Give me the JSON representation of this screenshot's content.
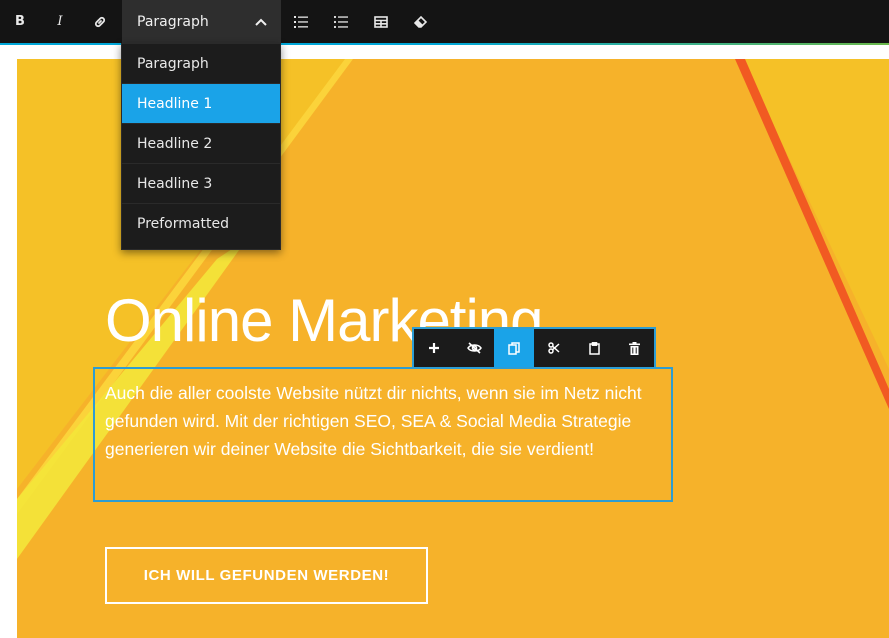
{
  "toolbar": {
    "bold_label": "B",
    "italic_label": "I",
    "format_select": {
      "value": "Paragraph"
    },
    "accent_color": "#1aa3e8"
  },
  "format_dropdown": {
    "items": [
      {
        "label": "Paragraph"
      },
      {
        "label": "Headline 1",
        "selected": true
      },
      {
        "label": "Headline 2"
      },
      {
        "label": "Headline 3"
      },
      {
        "label": "Preformatted"
      }
    ]
  },
  "block_toolbar": {
    "buttons": [
      {
        "icon": "plus-icon"
      },
      {
        "icon": "eye-off-icon"
      },
      {
        "icon": "copy-icon",
        "active": true
      },
      {
        "icon": "scissors-icon"
      },
      {
        "icon": "clipboard-icon"
      },
      {
        "icon": "trash-icon"
      }
    ]
  },
  "content": {
    "headline": "Online Marketing",
    "body": "Auch die aller coolste Website nützt dir nichts, wenn sie im Netz nicht gefunden wird. Mit der richtigen SEO, SEA & Social Media Strategie generieren wir deiner Website die Sichtbarkeit, die sie verdient!",
    "cta_label": "ICH WILL GEFUNDEN WERDEN!"
  },
  "colors": {
    "background_orange": "#f6b22a",
    "stripe_red": "#f15a22",
    "stripe_yellow": "#f4e63a",
    "selection_blue": "#2d9dd3"
  }
}
